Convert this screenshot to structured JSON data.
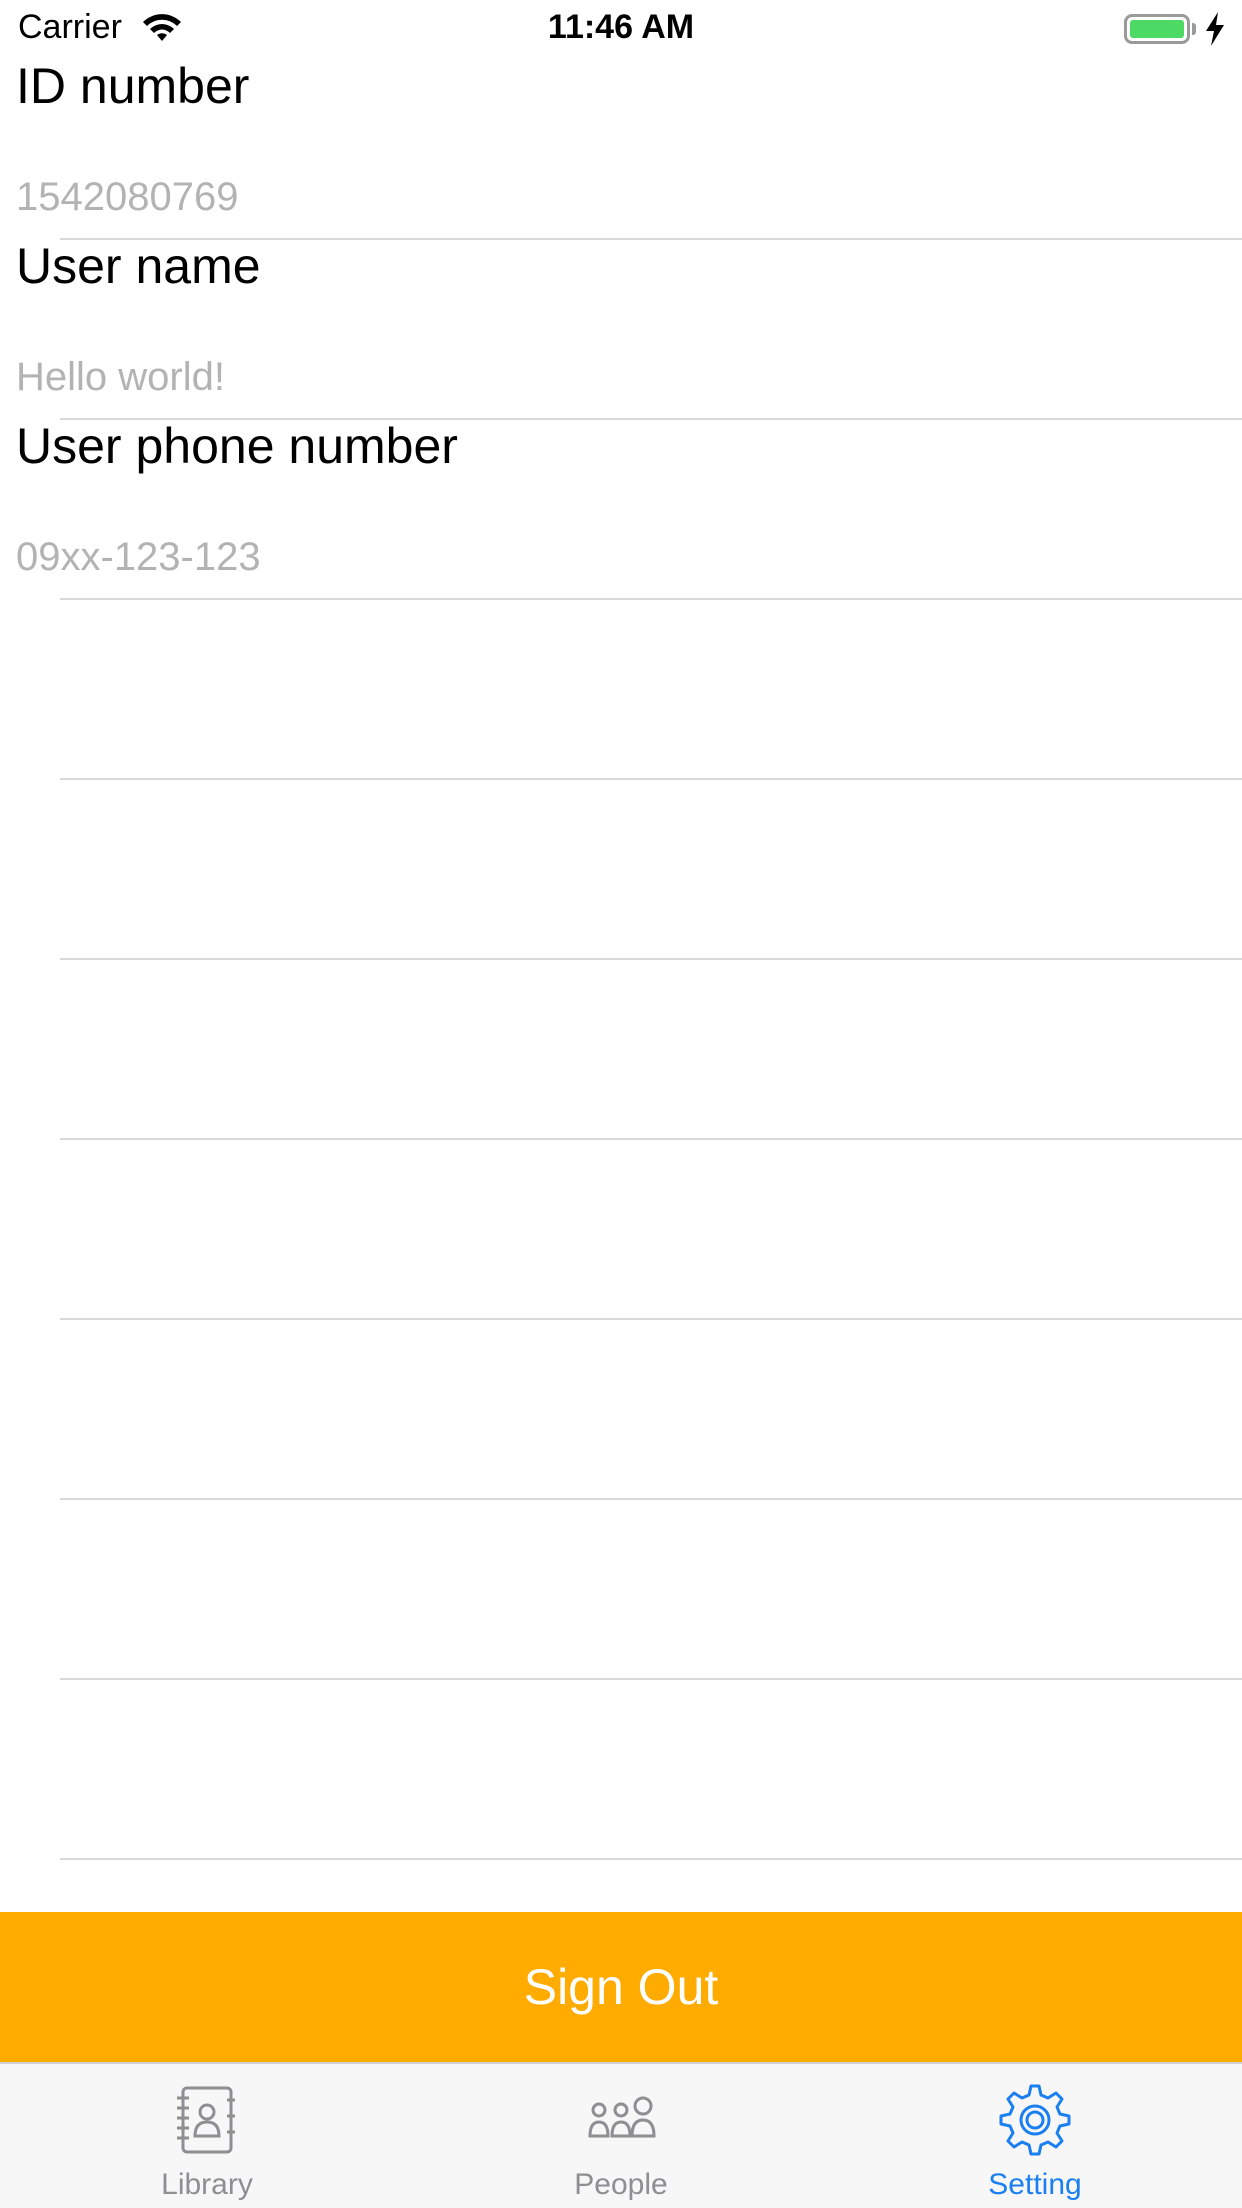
{
  "status_bar": {
    "carrier": "Carrier",
    "time": "11:46 AM",
    "wifi_icon": "wifi-icon",
    "battery_icon": "battery-charging-icon",
    "battery_color": "#4cd964"
  },
  "form": {
    "id_number": {
      "label": "ID number",
      "value": "1542080769"
    },
    "user_name": {
      "label": "User name",
      "value": "Hello world!"
    },
    "user_phone": {
      "label": "User phone number",
      "value": "09xx-123-123"
    }
  },
  "sign_out": {
    "label": "Sign Out",
    "color": "#ffab00"
  },
  "tabbar": {
    "tabs": [
      {
        "label": "Library",
        "icon": "contact-book-icon",
        "active": false
      },
      {
        "label": "People",
        "icon": "people-group-icon",
        "active": false
      },
      {
        "label": "Setting",
        "icon": "gear-icon",
        "active": true
      }
    ],
    "active_color": "#1a7ff0",
    "inactive_color": "#8e8e93"
  }
}
